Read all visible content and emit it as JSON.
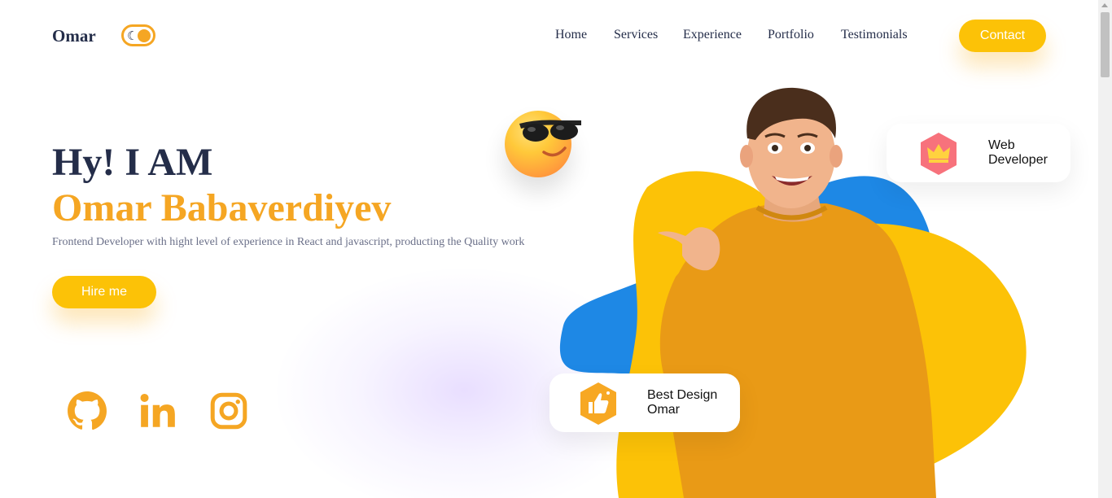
{
  "navbar": {
    "logo": "Omar",
    "items": [
      "Home",
      "Services",
      "Experience",
      "Portfolio",
      "Testimonials"
    ],
    "contact_label": "Contact",
    "theme_toggle_icon": "moon-icon"
  },
  "intro": {
    "greeting": "Hy! I AM",
    "name": "Omar Babaverdiyev",
    "description": "Frontend Developer with hight level of experience in React and javascript, producting the Quality work",
    "hire_label": "Hire me",
    "social_icons": [
      "github-icon",
      "linkedin-icon",
      "instagram-icon"
    ]
  },
  "cards": {
    "web": {
      "line1": "Web",
      "line2": "Developer",
      "icon": "crown-icon"
    },
    "best": {
      "line1": "Best Design",
      "line2": "Omar",
      "icon": "thumbs-up-icon"
    }
  },
  "colors": {
    "accent": "#f5a623",
    "button": "#fcc207",
    "dark": "#242d49",
    "blue_blob": "#1e88e5",
    "yellow_blob": "#fcc207"
  }
}
